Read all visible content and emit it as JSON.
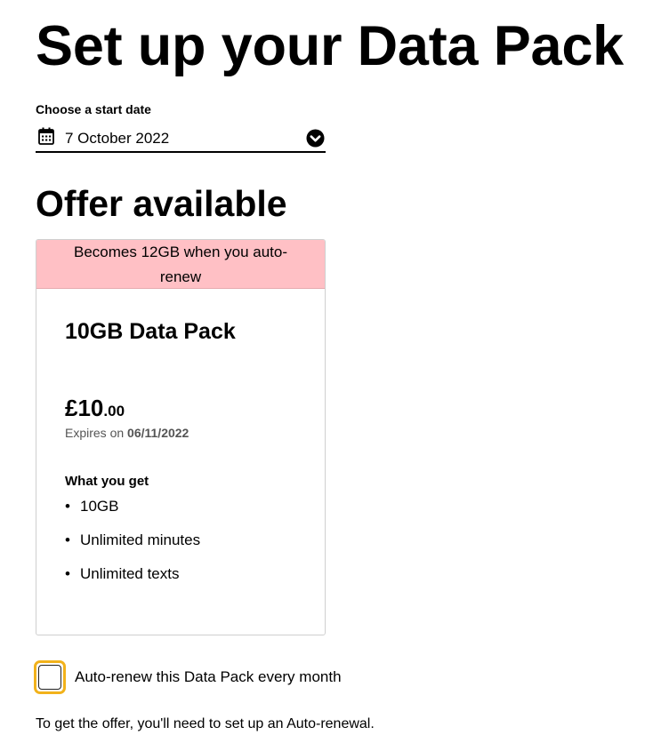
{
  "page": {
    "title": "Set up your Data Pack"
  },
  "start_date": {
    "label": "Choose a start date",
    "selected_value": "7 October 2022",
    "icon": "calendar-icon",
    "dropdown_icon": "chevron-down-icon"
  },
  "offer_section": {
    "title": "Offer available"
  },
  "offer_card": {
    "banner_line_1": "Becomes 12GB when you auto-",
    "banner_line_2": "renew",
    "banner_color": "#ffc0c5",
    "pack_name": "10GB Data Pack",
    "price_main": "£10",
    "price_pence": ".00",
    "expiry_prefix": "Expires on ",
    "expiry_date": "06/11/2022",
    "benefits_title": "What you get",
    "benefits": [
      "10GB",
      "Unlimited minutes",
      "Unlimited texts"
    ],
    "bullet": "•"
  },
  "auto_renew": {
    "label": "Auto-renew this Data Pack every month",
    "checked": false,
    "focus_color": "#f2b21b"
  },
  "offer_note": "To get the offer, you'll need to set up an Auto-renewal."
}
